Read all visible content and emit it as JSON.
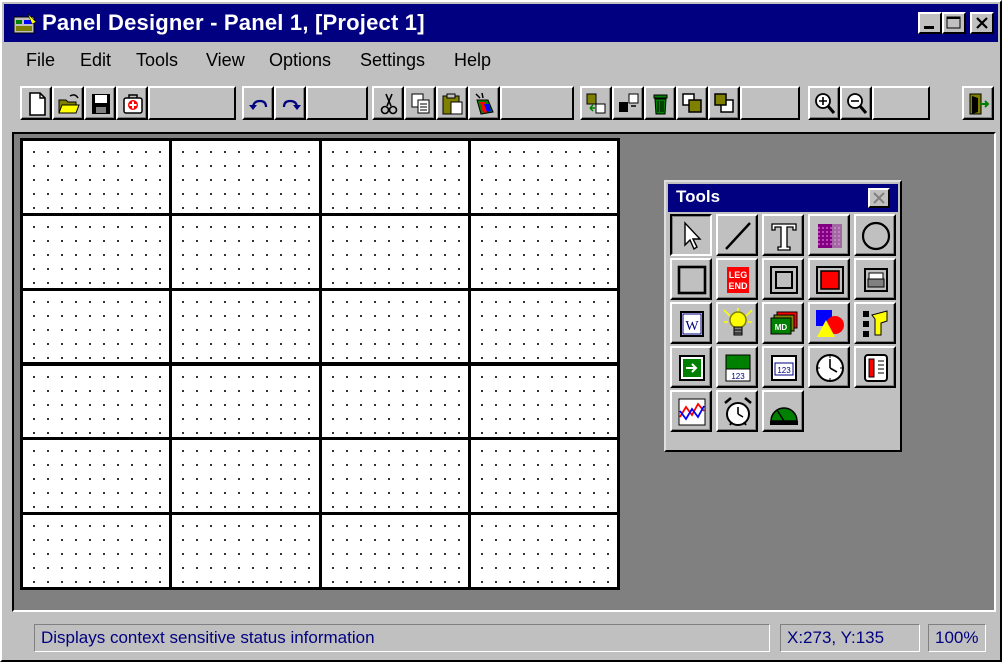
{
  "window": {
    "title": "Panel Designer - Panel 1, [Project 1]",
    "caption_buttons": [
      "minimize-icon",
      "maximize-icon",
      "close-icon"
    ]
  },
  "menu": [
    {
      "label": "File"
    },
    {
      "label": "Edit"
    },
    {
      "label": "Tools"
    },
    {
      "label": "View"
    },
    {
      "label": "Options"
    },
    {
      "label": "Settings"
    },
    {
      "label": "Help"
    }
  ],
  "toolbar": {
    "buttons": [
      "new-icon",
      "open-icon",
      "save-icon",
      "first-aid-icon",
      "undo-icon",
      "redo-icon",
      "cut-icon",
      "copy-icon",
      "paste-icon",
      "paint-icon",
      "align-left-icon",
      "align-right-icon",
      "delete-icon",
      "bring-front-icon",
      "send-back-icon",
      "zoom-in-icon",
      "zoom-out-icon",
      "exit-icon"
    ]
  },
  "panel": {
    "rows": 6,
    "cols": 4
  },
  "tools_palette": {
    "title": "Tools",
    "tools": [
      "pointer-icon",
      "line-icon",
      "text-icon",
      "pattern-icon",
      "circle-icon",
      "rectangle-icon",
      "legend-icon",
      "frame-icon",
      "filled-rectangle-icon",
      "printer-icon",
      "w-control-icon",
      "lightbulb-icon",
      "md-display-icon",
      "shapes-icon",
      "switch-icon",
      "arrow-button-icon",
      "numeric-bar-icon",
      "numeric-display-icon",
      "clock-icon",
      "meter-icon",
      "trend-chart-icon",
      "alarm-clock-icon",
      "gauge-icon"
    ],
    "legend_text": [
      "LEG",
      "END"
    ],
    "w_text": "W",
    "md_text": "MD",
    "num_text": "123"
  },
  "status": {
    "message": "Displays context sensitive status information",
    "coordinates": "X:273, Y:135",
    "zoom": "100%"
  }
}
